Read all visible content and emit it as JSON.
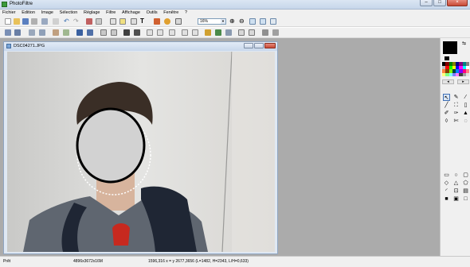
{
  "app": {
    "title": "PhotoFiltre"
  },
  "menu": [
    "Fichier",
    "Edition",
    "Image",
    "Sélection",
    "Réglage",
    "Filtre",
    "Affichage",
    "Outils",
    "Fenêtre",
    "?"
  ],
  "toolbar": {
    "zoom": "16%"
  },
  "document": {
    "title": "DSC04271.JPG"
  },
  "status": {
    "state": "Prêt",
    "size": "4896x3672x16M",
    "info": "1596,316 x = y 2677,3656 (L=1482, H=2343, L/H=0,633)"
  },
  "palette_colors": [
    "#000000",
    "#800000",
    "#008000",
    "#808000",
    "#000080",
    "#800080",
    "#008080",
    "#808080",
    "#c0c0c0",
    "#ff0000",
    "#00ff00",
    "#ffff00",
    "#0000ff",
    "#ff00ff",
    "#00ffff",
    "#ffffff",
    "#ff8040",
    "#804000",
    "#80ff00",
    "#004040",
    "#0080ff",
    "#8000ff",
    "#ff0080",
    "#ff8080",
    "#ffff80",
    "#80ff80",
    "#80ffff",
    "#8080ff",
    "#ff80ff",
    "#404040",
    "#a0a0a0",
    "#e0e0e0"
  ],
  "icons": [
    "new-icon",
    "open-icon",
    "save-icon",
    "print-icon",
    "undo-icon",
    "redo-icon",
    "cut-icon",
    "copy-icon",
    "paste-icon",
    "text-icon",
    "zoom-in-icon",
    "zoom-out-icon",
    "pointer-icon",
    "pipette-icon",
    "wand-icon",
    "brush-icon",
    "fill-icon",
    "eraser-icon",
    "rectangle-icon",
    "ellipse-icon",
    "polygon-icon"
  ]
}
